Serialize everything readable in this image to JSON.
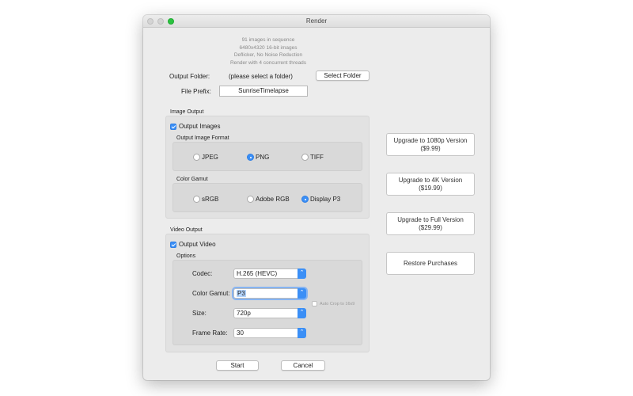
{
  "window": {
    "title": "Render"
  },
  "info": {
    "line1": "91 images in sequence",
    "line2": "6480x4320 16-bit images",
    "line3": "Deflicker, No Noise Reduction",
    "line4": "Render with 4 concurrent threads"
  },
  "output": {
    "folder_label": "Output Folder:",
    "folder_value": "(please select a folder)",
    "select_folder_button": "Select Folder",
    "prefix_label": "File Prefix:",
    "prefix_value": "SunriseTimelapse"
  },
  "image_output": {
    "group_title": "Image Output",
    "output_images_label": "Output Images",
    "output_images_checked": true,
    "format_title": "Output Image Format",
    "formats": [
      "JPEG",
      "PNG",
      "TIFF"
    ],
    "selected_format": "PNG",
    "gamut_title": "Color Gamut",
    "gamuts": [
      "sRGB",
      "Adobe RGB",
      "Display P3"
    ],
    "selected_gamut": "Display P3"
  },
  "video_output": {
    "group_title": "Video Output",
    "output_video_label": "Output Video",
    "output_video_checked": true,
    "options_title": "Options",
    "codec_label": "Codec:",
    "codec_value": "H.265 (HEVC)",
    "gamut_label": "Color Gamut:",
    "gamut_value": "P3",
    "auto_crop_label": "Auto Crop to 16x9",
    "size_label": "Size:",
    "size_value": "720p",
    "framerate_label": "Frame Rate:",
    "framerate_value": "30"
  },
  "actions": {
    "start": "Start",
    "cancel": "Cancel"
  },
  "upgrades": {
    "u1080_line1": "Upgrade to 1080p Version",
    "u1080_line2": "($9.99)",
    "u4k_line1": "Upgrade to 4K Version",
    "u4k_line2": "($19.99)",
    "ufull_line1": "Upgrade to Full Version",
    "ufull_line2": "($29.99)",
    "restore": "Restore Purchases"
  },
  "colors": {
    "accent": "#3b8ff6",
    "window_bg": "#ececec",
    "zoom_light": "#2ac33f"
  },
  "icons": {
    "checkbox": "checkmark-icon",
    "popup_arrow": "chevron-updown-icon"
  }
}
